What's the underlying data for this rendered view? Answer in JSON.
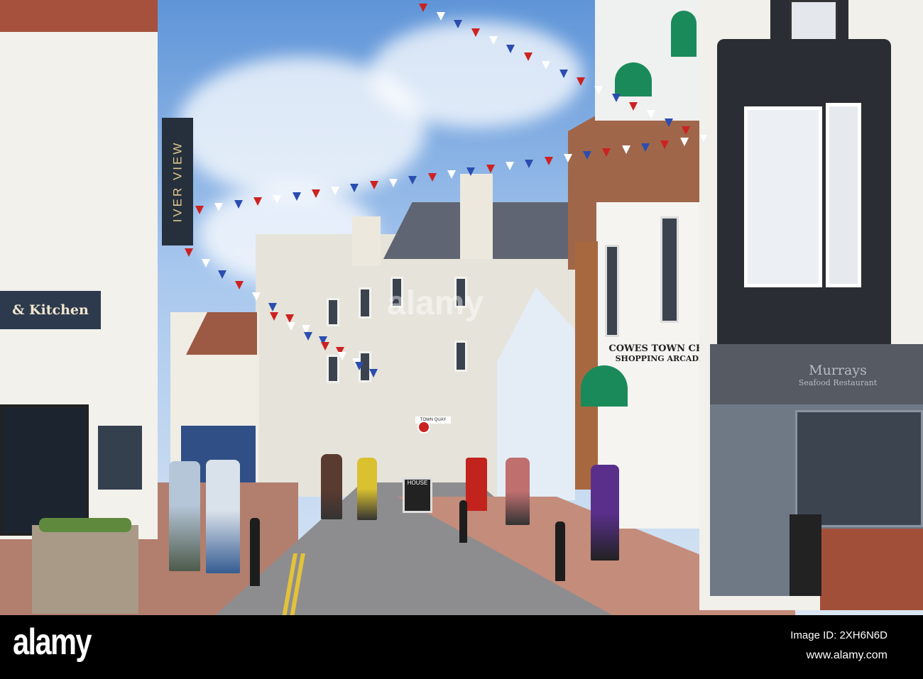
{
  "photo": {
    "signs": {
      "kitchen": "& Kitchen",
      "river_view": "IVER VIEW",
      "arcade_line1": "COWES TOWN CEN",
      "arcade_line2": "SHOPPING ARCADE",
      "restaurant_name": "Murrays",
      "restaurant_sub": "Seafood Restaurant",
      "aboard": "HOUSE",
      "street": "TOWN QUAY"
    },
    "watermark": "alamy"
  },
  "footer": {
    "logo": "alamy",
    "image_id": "Image ID: 2XH6N6D",
    "url": "www.alamy.com"
  },
  "colors": {
    "sky": "#6a9edc",
    "awning": "#1a8a5a",
    "footer": "#000000"
  }
}
